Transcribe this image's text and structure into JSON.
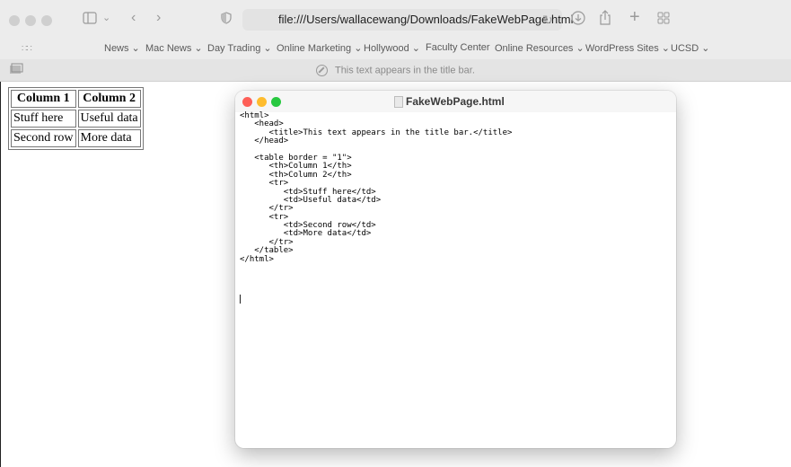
{
  "browser": {
    "url": "file:///Users/wallacewang/Downloads/FakeWebPage.html",
    "page_title": "This text appears in the title bar.",
    "bookmarks": [
      "News ⌄",
      "Mac News ⌄",
      "Day Trading ⌄",
      "Online Marketing ⌄",
      "Hollywood ⌄",
      "Faculty Center",
      "Online Resources ⌄",
      "WordPress Sites ⌄",
      "UCSD ⌄"
    ],
    "icons": {
      "sidebar": "sidebar-icon",
      "back": "chevron-left-icon",
      "forward": "chevron-right-icon",
      "shield": "shield-icon",
      "reload": "reload-icon",
      "download": "download-icon",
      "share": "share-icon",
      "new_tab": "plus-icon",
      "tab_overview": "grid-icon",
      "apps": "apps-grid-icon"
    }
  },
  "rendered_table": {
    "headers": [
      "Column 1",
      "Column 2"
    ],
    "rows": [
      [
        "Stuff here",
        "Useful data"
      ],
      [
        "Second row",
        "More data"
      ]
    ]
  },
  "editor": {
    "title": "FakeWebPage.html",
    "lines": [
      "<html>",
      "   <head>",
      "      <title>This text appears in the title bar.</title>",
      "   </head>",
      "",
      "   <table border = \"1\">",
      "      <th>Column 1</th>",
      "      <th>Column 2</th>",
      "      <tr>",
      "         <td>Stuff here</td>",
      "         <td>Useful data</td>",
      "      </tr>",
      "      <tr>",
      "         <td>Second row</td>",
      "         <td>More data</td>",
      "      </tr>",
      "   </table>",
      "</html>"
    ]
  },
  "colors": {
    "close": "#fe5f57",
    "minimize": "#febc2e",
    "zoom": "#28c840",
    "inactive_dot": "#cfcfcf"
  }
}
